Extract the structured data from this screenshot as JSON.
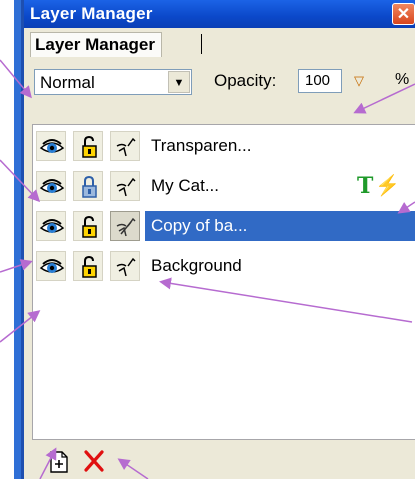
{
  "window": {
    "title": "Layer Manager",
    "close_glyph": "✕"
  },
  "tabs": [
    {
      "label": "Layer Manager"
    }
  ],
  "controls": {
    "blend_mode": "Normal",
    "opacity_label": "Opacity:",
    "opacity_value": "100",
    "opacity_unit": "%"
  },
  "layers": [
    {
      "name": "Transparen...",
      "selected": false,
      "locked": false,
      "is_text": false
    },
    {
      "name": "My Cat...",
      "selected": false,
      "locked": true,
      "is_text": true
    },
    {
      "name": "Copy of ba...",
      "selected": true,
      "locked": false,
      "is_text": false
    },
    {
      "name": "Background",
      "selected": false,
      "locked": false,
      "is_text": false
    }
  ],
  "layer_icons": {
    "text_glyph": "T",
    "bolt_glyph": "⚡"
  },
  "colors": {
    "titlebar": "#0b48c9",
    "selection": "#316ac5",
    "callout": "#b66bd0",
    "delete": "#e01010"
  }
}
